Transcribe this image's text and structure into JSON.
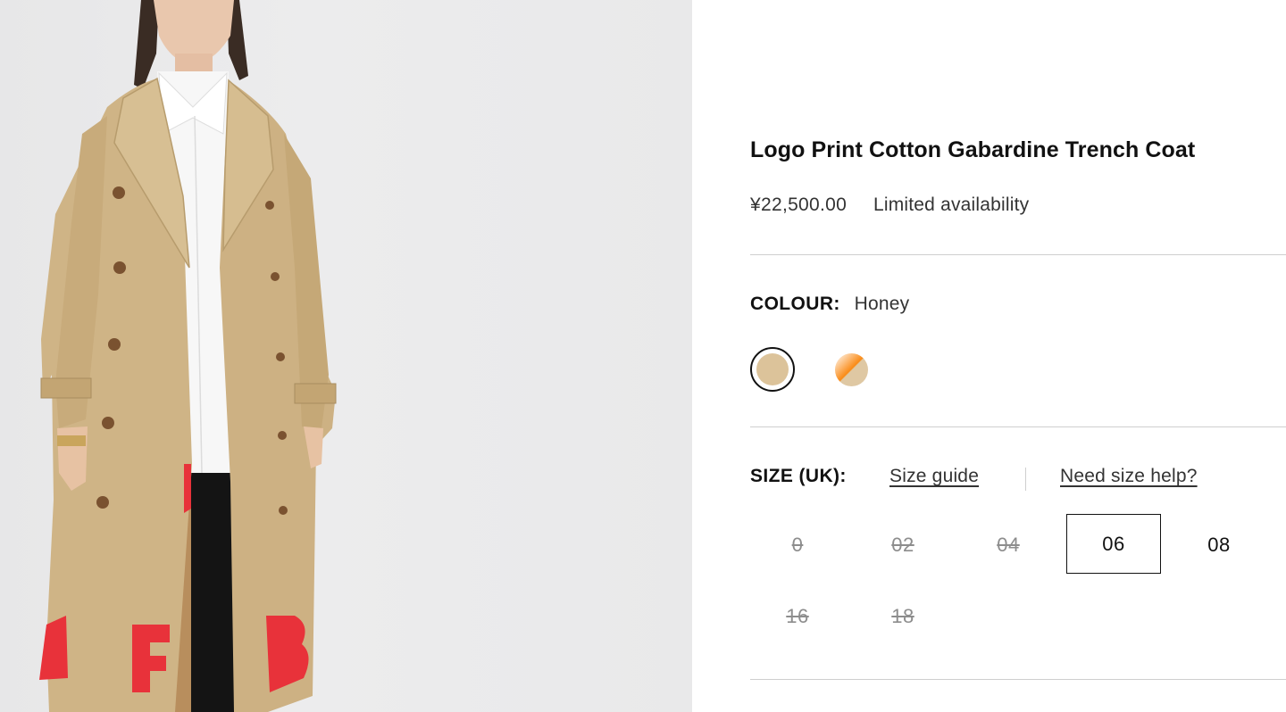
{
  "product": {
    "title": "Logo Print Cotton Gabardine Trench Coat",
    "price": "¥22,500.00",
    "availability": "Limited availability"
  },
  "colour": {
    "label": "COLOUR:",
    "selected": "Honey",
    "swatches": [
      {
        "name": "Honey",
        "color": "#dcc39a",
        "selected": true
      },
      {
        "name": "Honey / Orange",
        "color": "#fa8a15",
        "selected": false
      }
    ]
  },
  "size": {
    "label": "SIZE (UK):",
    "guide_link": "Size guide",
    "help_link": "Need size help?",
    "options": [
      {
        "label": "0",
        "available": false,
        "selected": false
      },
      {
        "label": "02",
        "available": false,
        "selected": false
      },
      {
        "label": "04",
        "available": false,
        "selected": false
      },
      {
        "label": "06",
        "available": true,
        "selected": true
      },
      {
        "label": "08",
        "available": true,
        "selected": false
      },
      {
        "label": "16",
        "available": false,
        "selected": false
      },
      {
        "label": "18",
        "available": false,
        "selected": false
      }
    ]
  },
  "image": {
    "alt_subject": "model-wearing-trench-coat",
    "coat_color": "#cfb486",
    "print_color": "#e8323a"
  }
}
